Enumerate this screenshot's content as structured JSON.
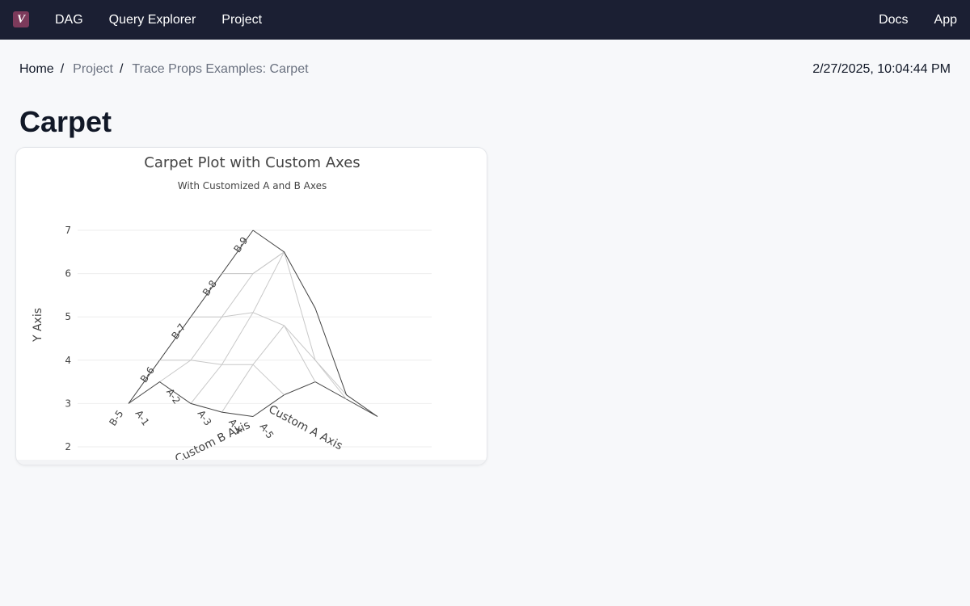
{
  "nav": {
    "logo_letter": "V",
    "left": [
      "DAG",
      "Query Explorer",
      "Project"
    ],
    "right": [
      "Docs",
      "App"
    ]
  },
  "breadcrumb": {
    "home": "Home",
    "project": "Project",
    "current": "Trace Props Examples: Carpet",
    "separator": "/"
  },
  "timestamp": "2/27/2025, 10:04:44 PM",
  "page": {
    "title": "Carpet"
  },
  "chart_data": {
    "type": "carpet",
    "title": "Carpet Plot with Custom Axes",
    "subtitle": "With Customized A and B Axes",
    "ylabel": "Y Axis",
    "ylim": [
      2,
      7.4
    ],
    "yticks": [
      2,
      3,
      4,
      5,
      6,
      7
    ],
    "grid": true,
    "a": [
      1,
      2,
      3,
      4,
      5
    ],
    "b": [
      5,
      6,
      7,
      8,
      9
    ],
    "y": [
      [
        3,
        4,
        5,
        6,
        7
      ],
      [
        3.5,
        4,
        5,
        6,
        6.5
      ],
      [
        3,
        3.9,
        5.1,
        6.5,
        5.2
      ],
      [
        2.8,
        3.9,
        4.8,
        4,
        3.2
      ],
      [
        2.7,
        3.2,
        3.5,
        3.1,
        2.7
      ]
    ],
    "aaxis": {
      "title": "Custom A Axis",
      "tickprefix": "A-"
    },
    "baxis": {
      "title": "Custom B Axis",
      "tickprefix": "B-"
    },
    "colors": {
      "boundary": "#444444",
      "gridline": "#c8c8c8",
      "axis_grid": "#eeeeee",
      "text": "#444444"
    }
  }
}
